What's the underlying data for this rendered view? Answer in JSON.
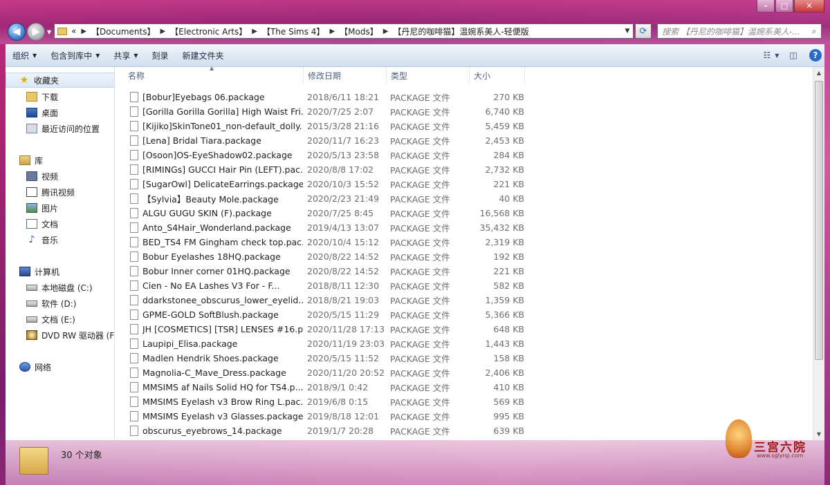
{
  "window": {
    "controls": {
      "minimize": "–",
      "maximize": "□",
      "close": "✕"
    }
  },
  "nav": {
    "back_icon": "back-arrow-icon",
    "forward_icon": "forward-arrow-icon"
  },
  "address": {
    "prefix": "«",
    "crumbs": [
      "【Documents】",
      "【Electronic Arts】",
      "【The Sims 4】",
      "【Mods】",
      "【丹尼的咖啡猫】温婉系美人-轻便版"
    ],
    "separator": "▶"
  },
  "search": {
    "placeholder": "搜索 【丹尼的咖啡猫】温婉系美人-..."
  },
  "toolbar": {
    "organize": "组织",
    "include_library": "包含到库中",
    "share": "共享",
    "burn": "刻录",
    "new_folder": "新建文件夹"
  },
  "sidebar": {
    "favorites": {
      "label": "收藏夹",
      "items": [
        "下载",
        "桌面",
        "最近访问的位置"
      ]
    },
    "libraries": {
      "label": "库",
      "items": [
        "视频",
        "腾讯视频",
        "图片",
        "文档",
        "音乐"
      ]
    },
    "computer": {
      "label": "计算机",
      "items": [
        "本地磁盘 (C:)",
        "软件 (D:)",
        "文档 (E:)",
        "DVD RW 驱动器 (F:"
      ]
    },
    "network": {
      "label": "网络"
    }
  },
  "columns": {
    "name": "名称",
    "date": "修改日期",
    "type": "类型",
    "size": "大小"
  },
  "files": [
    {
      "name": "[Bobur]Eyebags 06.package",
      "date": "2018/6/11 18:21",
      "type": "PACKAGE 文件",
      "size": "270 KB"
    },
    {
      "name": "[Gorilla Gorilla Gorilla] High Waist Fri...",
      "date": "2020/7/25 2:07",
      "type": "PACKAGE 文件",
      "size": "6,740 KB"
    },
    {
      "name": "[Kijiko]SkinTone01_non-default_dolly....",
      "date": "2015/3/28 21:16",
      "type": "PACKAGE 文件",
      "size": "5,459 KB"
    },
    {
      "name": "[Lena] Bridal Tiara.package",
      "date": "2020/11/7 16:23",
      "type": "PACKAGE 文件",
      "size": "2,453 KB"
    },
    {
      "name": "[Osoon]OS-EyeShadow02.package",
      "date": "2020/5/13 23:58",
      "type": "PACKAGE 文件",
      "size": "284 KB"
    },
    {
      "name": "[RIMINGs] GUCCI Hair Pin (LEFT).pac...",
      "date": "2020/8/8 17:02",
      "type": "PACKAGE 文件",
      "size": "2,732 KB"
    },
    {
      "name": "[SugarOwl] DelicateEarrings.package",
      "date": "2020/10/3 15:52",
      "type": "PACKAGE 文件",
      "size": "221 KB"
    },
    {
      "name": "【Sylvia】Beauty Mole.package",
      "date": "2020/2/23 21:49",
      "type": "PACKAGE 文件",
      "size": "40 KB"
    },
    {
      "name": "ALGU GUGU SKIN (F).package",
      "date": "2020/7/25 8:45",
      "type": "PACKAGE 文件",
      "size": "16,568 KB"
    },
    {
      "name": "Anto_S4Hair_Wonderland.package",
      "date": "2019/4/13 13:07",
      "type": "PACKAGE 文件",
      "size": "35,432 KB"
    },
    {
      "name": "BED_TS4 FM Gingham check top.pac...",
      "date": "2020/10/4 15:12",
      "type": "PACKAGE 文件",
      "size": "2,319 KB"
    },
    {
      "name": "Bobur Eyelashes 18HQ.package",
      "date": "2020/8/22 14:52",
      "type": "PACKAGE 文件",
      "size": "192 KB"
    },
    {
      "name": "Bobur Inner corner 01HQ.package",
      "date": "2020/8/22 14:52",
      "type": "PACKAGE 文件",
      "size": "221 KB"
    },
    {
      "name": "Cien  -  No EA Lashes V3  For  -  F...",
      "date": "2018/8/11 12:30",
      "type": "PACKAGE 文件",
      "size": "582 KB"
    },
    {
      "name": "ddarkstonee_obscurus_lower_eyelid....",
      "date": "2018/8/21 19:03",
      "type": "PACKAGE 文件",
      "size": "1,359 KB"
    },
    {
      "name": "GPME-GOLD SoftBlush.package",
      "date": "2020/5/15 11:29",
      "type": "PACKAGE 文件",
      "size": "5,366 KB"
    },
    {
      "name": "JH [COSMETICS] [TSR] LENSES #16.p...",
      "date": "2020/11/28 17:13",
      "type": "PACKAGE 文件",
      "size": "648 KB"
    },
    {
      "name": "Laupipi_Elisa.package",
      "date": "2020/11/19 23:03",
      "type": "PACKAGE 文件",
      "size": "1,443 KB"
    },
    {
      "name": "Madlen Hendrik Shoes.package",
      "date": "2020/5/15 11:52",
      "type": "PACKAGE 文件",
      "size": "158 KB"
    },
    {
      "name": "Magnolia-C_Mave_Dress.package",
      "date": "2020/11/20 20:52",
      "type": "PACKAGE 文件",
      "size": "2,406 KB"
    },
    {
      "name": "MMSIMS af Nails Solid HQ for TS4.p...",
      "date": "2018/9/1 0:42",
      "type": "PACKAGE 文件",
      "size": "410 KB"
    },
    {
      "name": "MMSIMS Eyelash v3 Brow Ring L.pac...",
      "date": "2019/6/8 0:15",
      "type": "PACKAGE 文件",
      "size": "569 KB"
    },
    {
      "name": "MMSIMS Eyelash v3 Glasses.package",
      "date": "2019/8/18 12:01",
      "type": "PACKAGE 文件",
      "size": "995 KB"
    },
    {
      "name": "obscurus_eyebrows_14.package",
      "date": "2019/1/7 20:28",
      "type": "PACKAGE 文件",
      "size": "639 KB"
    }
  ],
  "status": {
    "count": "30 个对象"
  },
  "watermark": {
    "title": "三宫六院",
    "url": "www.sglynp.com"
  }
}
